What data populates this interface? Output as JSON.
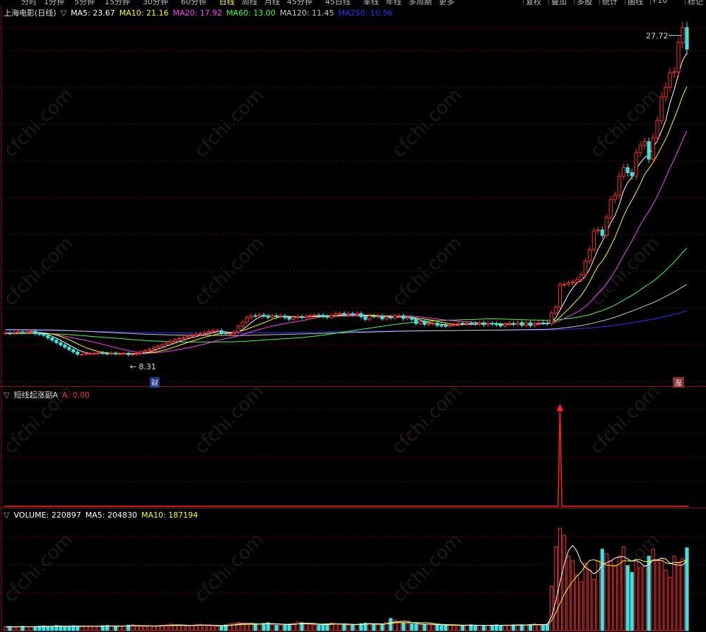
{
  "toolbar": {
    "tabs": [
      "分时",
      "1分钟",
      "5分钟",
      "15分钟",
      "30分钟",
      "60分钟",
      "日线",
      "周线",
      "月线",
      "45分钟",
      "45日线",
      "季线",
      "年线",
      "多周期",
      "更多"
    ],
    "right_buttons": [
      "复权",
      "叠加",
      "多股",
      "统计",
      "画线",
      "F10",
      "标记"
    ]
  },
  "main": {
    "stock_title": "上海电影(日线)",
    "ma": [
      {
        "label": "MA5: 23.67",
        "color": "#ffffff"
      },
      {
        "label": "MA10: 21.16",
        "color": "#ffff00"
      },
      {
        "label": "MA20: 17.92",
        "color": "#ff40ff"
      },
      {
        "label": "MA60: 13.00",
        "color": "#40ff40"
      },
      {
        "label": "MA120: 11.45",
        "color": "#c8c8c8"
      },
      {
        "label": "MA250: 10.56",
        "color": "#3030ff"
      }
    ],
    "high_label": "27.72",
    "low_label": "8.31",
    "badge_cai": "财",
    "badge_limit": "涨"
  },
  "indicator": {
    "title": "短线起涨副A",
    "value": "A: 0.00"
  },
  "volume": {
    "labels": [
      {
        "label": "VOLUME: 220897",
        "color": "#ffffff"
      },
      {
        "label": "MA5: 204830",
        "color": "#ffffff"
      },
      {
        "label": "MA10: 187194",
        "color": "#ffff00"
      }
    ]
  },
  "watermark": "cfchi.com",
  "chart_data": {
    "type": "candlestick",
    "price_ylim": [
      7,
      29
    ],
    "x": [
      1,
      2,
      3,
      4,
      5,
      6,
      7,
      8,
      9,
      10,
      11,
      12,
      13,
      14,
      15,
      16,
      17,
      18,
      19,
      20,
      21,
      22,
      23,
      24,
      25,
      26,
      27,
      28,
      29,
      30,
      31,
      32,
      33,
      34,
      35,
      36,
      37,
      38,
      39,
      40,
      41,
      42,
      43,
      44,
      45,
      46,
      47,
      48,
      49,
      50,
      51,
      52,
      53,
      54,
      55,
      56,
      57,
      58,
      59,
      60,
      61,
      62,
      63,
      64,
      65,
      66,
      67,
      68,
      69,
      70,
      71,
      72,
      73,
      74,
      75,
      76,
      77,
      78,
      79,
      80,
      81,
      82,
      83,
      84,
      85,
      86,
      87,
      88,
      89,
      90,
      91,
      92,
      93,
      94,
      95,
      96,
      97,
      98,
      99,
      100,
      101,
      102,
      103,
      104,
      105,
      106,
      107,
      108,
      109,
      110,
      111,
      112,
      113,
      114,
      115,
      116,
      117,
      118,
      119,
      120,
      121,
      122,
      123,
      124,
      125,
      126,
      127,
      128,
      129,
      130,
      131,
      132,
      133,
      134,
      135,
      136,
      137,
      138,
      139,
      140,
      141,
      142,
      143,
      144,
      145,
      146,
      147,
      148,
      149,
      150,
      151,
      152,
      153,
      154,
      155,
      156,
      157,
      158,
      159,
      160,
      161,
      162
    ],
    "close": [
      9.9,
      9.88,
      9.92,
      9.96,
      9.93,
      9.97,
      10,
      9.85,
      9.82,
      9.75,
      9.6,
      9.46,
      9.32,
      9.18,
      9.04,
      8.9,
      8.76,
      8.62,
      8.62,
      8.66,
      8.67,
      8.68,
      8.72,
      8.67,
      8.65,
      8.69,
      8.64,
      8.66,
      8.68,
      8.6,
      8.62,
      8.66,
      8.75,
      8.84,
      8.93,
      9.02,
      9.11,
      9.2,
      9.29,
      9.38,
      9.47,
      9.56,
      9.62,
      9.68,
      9.74,
      9.8,
      9.86,
      9.92,
      9.98,
      10.04,
      10.04,
      9.9,
      9.85,
      9.85,
      9.95,
      10.3,
      10.55,
      10.82,
      10.93,
      10.92,
      10.98,
      10.92,
      10.83,
      10.93,
      10.88,
      10.92,
      10.82,
      10.72,
      10.84,
      10.88,
      10.83,
      10.89,
      10.96,
      10.97,
      10.96,
      10.9,
      10.84,
      10.95,
      11.06,
      11.07,
      10.98,
      11.05,
      10.99,
      11.06,
      10.87,
      10.71,
      10.92,
      10.89,
      10.92,
      10.74,
      10.85,
      10.8,
      10.93,
      10.93,
      10.76,
      10.82,
      10.71,
      10.46,
      10.59,
      10.41,
      10.47,
      10.48,
      10.35,
      10.34,
      10.31,
      10.38,
      10.41,
      10.48,
      10.46,
      10.48,
      10.47,
      10.44,
      10.51,
      10.39,
      10.47,
      10.46,
      10.39,
      10.32,
      10.44,
      10.47,
      10.43,
      10.52,
      10.36,
      10.51,
      10.34,
      10.46,
      10.5,
      10.49,
      10.46,
      11.1,
      11.45,
      12.8,
      12.8,
      12.9,
      12.95,
      13.1,
      13.4,
      14.2,
      14.9,
      16.01,
      16.07,
      15.74,
      16.82,
      17.88,
      18.16,
      19.3,
      19.8,
      19.5,
      19.3,
      20.7,
      21.14,
      21.36,
      20.31,
      21.6,
      22.62,
      24.04,
      24.63,
      25.49,
      25.54,
      27.29,
      28.2,
      26.9
    ],
    "volume_ylim": [
      0,
      240000
    ],
    "volume": [
      8000,
      9000,
      7500,
      8500,
      9200,
      8000,
      7800,
      8800,
      9500,
      10200,
      9000,
      8500,
      11000,
      9800,
      8900,
      9200,
      10500,
      9700,
      8600,
      9000,
      8700,
      9300,
      9900,
      10600,
      11200,
      9400,
      8800,
      9600,
      10400,
      11800,
      12500,
      9800,
      8900,
      9300,
      10100,
      9600,
      10800,
      11500,
      12300,
      13800,
      12000,
      11200,
      10500,
      9800,
      10900,
      12600,
      13500,
      11900,
      10300,
      9700,
      9200,
      10500,
      12200,
      14500,
      15800,
      17200,
      16100,
      14800,
      13600,
      12900,
      14200,
      15500,
      16800,
      13200,
      12100,
      11500,
      12800,
      13900,
      15200,
      18500,
      16900,
      14300,
      13700,
      12500,
      11800,
      12300,
      14600,
      16200,
      15100,
      13800,
      12600,
      11900,
      12700,
      13500,
      14900,
      16300,
      15800,
      14200,
      13100,
      12400,
      17900,
      26000,
      22500,
      18700,
      16400,
      15200,
      14600,
      13900,
      12800,
      13600,
      14100,
      12500,
      11700,
      10900,
      11300,
      12100,
      11800,
      10700,
      10200,
      11400,
      12600,
      11900,
      10800,
      10400,
      11100,
      11700,
      12400,
      11500,
      10900,
      11200,
      12300,
      13200,
      12600,
      11800,
      12900,
      14200,
      13100,
      12400,
      13700,
      95000,
      180000,
      220000,
      205000,
      160000,
      150000,
      120000,
      105000,
      145000,
      130000,
      110000,
      150000,
      175000,
      165000,
      150000,
      140000,
      160000,
      180000,
      140000,
      125000,
      150000,
      135000,
      140000,
      160000,
      175000,
      150000,
      155000,
      130000,
      115000,
      160000,
      145000,
      155000,
      178000
    ],
    "indicator_ylim": [
      0,
      1
    ],
    "indicator": [
      0,
      0,
      0,
      0,
      0,
      0,
      0,
      0,
      0,
      0,
      0,
      0,
      0,
      0,
      0,
      0,
      0,
      0,
      0,
      0,
      0,
      0,
      0,
      0,
      0,
      0,
      0,
      0,
      0,
      0,
      0,
      0,
      0,
      0,
      0,
      0,
      0,
      0,
      0,
      0,
      0,
      0,
      0,
      0,
      0,
      0,
      0,
      0,
      0,
      0,
      0,
      0,
      0,
      0,
      0,
      0,
      0,
      0,
      0,
      0,
      0,
      0,
      0,
      0,
      0,
      0,
      0,
      0,
      0,
      0,
      0,
      0,
      0,
      0,
      0,
      0,
      0,
      0,
      0,
      0,
      0,
      0,
      0,
      0,
      0,
      0,
      0,
      0,
      0,
      0,
      0,
      0,
      0,
      0,
      0,
      0,
      0,
      0,
      0,
      0,
      0,
      0,
      0,
      0,
      0,
      0,
      0,
      0,
      0,
      0,
      0,
      0,
      0,
      0,
      0,
      0,
      0,
      0,
      0,
      0,
      0,
      0,
      0,
      0,
      0,
      0,
      0,
      0,
      0,
      0,
      0,
      1,
      0,
      0,
      0,
      0,
      0,
      0,
      0,
      0,
      0,
      0,
      0,
      0,
      0,
      0,
      0,
      0,
      0,
      0,
      0,
      0,
      0,
      0,
      0,
      0,
      0,
      0,
      0,
      0,
      0,
      0
    ]
  }
}
